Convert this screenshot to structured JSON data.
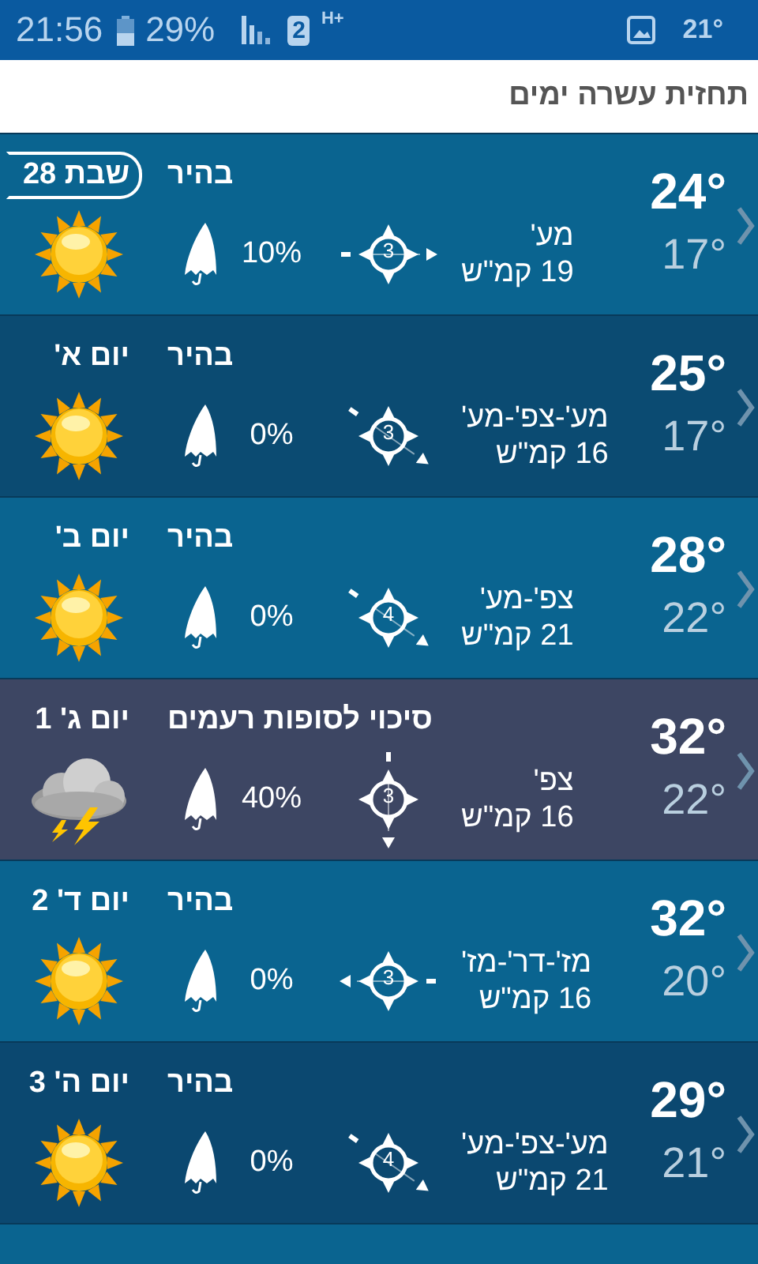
{
  "status_bar": {
    "time": "21:56",
    "battery": "29%",
    "sim": "2",
    "network": "H+",
    "temperature": "21°"
  },
  "title": "תחזית עשרה ימים",
  "days": [
    {
      "day": "שבת 28",
      "today": true,
      "condition": "בהיר",
      "kind": "sunny",
      "color": "#0a6490",
      "rain": "10%",
      "compass": {
        "kind": "east",
        "force": "3"
      },
      "wind_dir": "מע'",
      "wind_speed": "19 קמ\"ש",
      "high": "24°",
      "low": "17°"
    },
    {
      "day": "יום א'",
      "today": false,
      "condition": "בהיר",
      "kind": "sunny",
      "color": "#0b4b72",
      "rain": "0%",
      "compass": {
        "kind": "southeast",
        "force": "3"
      },
      "wind_dir": "מע'-צפ'-מע'",
      "wind_speed": "16 קמ\"ש",
      "high": "25°",
      "low": "17°"
    },
    {
      "day": "יום ב'",
      "today": false,
      "condition": "בהיר",
      "kind": "sunny",
      "color": "#0a6490",
      "rain": "0%",
      "compass": {
        "kind": "southeast",
        "force": "4"
      },
      "wind_dir": "צפ'-מע'",
      "wind_speed": "21 קמ\"ש",
      "high": "28°",
      "low": "22°"
    },
    {
      "day": "יום ג' 1",
      "today": false,
      "condition": "סיכוי לסופות רעמים",
      "kind": "storm",
      "color": "#3d4663",
      "rain": "40%",
      "compass": {
        "kind": "south",
        "force": "3"
      },
      "wind_dir": "צפ'",
      "wind_speed": "16 קמ\"ש",
      "high": "32°",
      "low": "22°"
    },
    {
      "day": "יום ד' 2",
      "today": false,
      "condition": "בהיר",
      "kind": "sunny",
      "color": "#0a6490",
      "rain": "0%",
      "compass": {
        "kind": "west",
        "force": "3"
      },
      "wind_dir": "מז'-דר'-מז'",
      "wind_speed": "16 קמ\"ש",
      "high": "32°",
      "low": "20°"
    },
    {
      "day": "יום ה' 3",
      "today": false,
      "condition": "בהיר",
      "kind": "sunny",
      "color": "#0b4870",
      "rain": "0%",
      "compass": {
        "kind": "southeast",
        "force": "4"
      },
      "wind_dir": "מע'-צפ'-מע'",
      "wind_speed": "21 קמ\"ש",
      "high": "29°",
      "low": "21°"
    },
    {
      "color": "#0a6490"
    }
  ]
}
